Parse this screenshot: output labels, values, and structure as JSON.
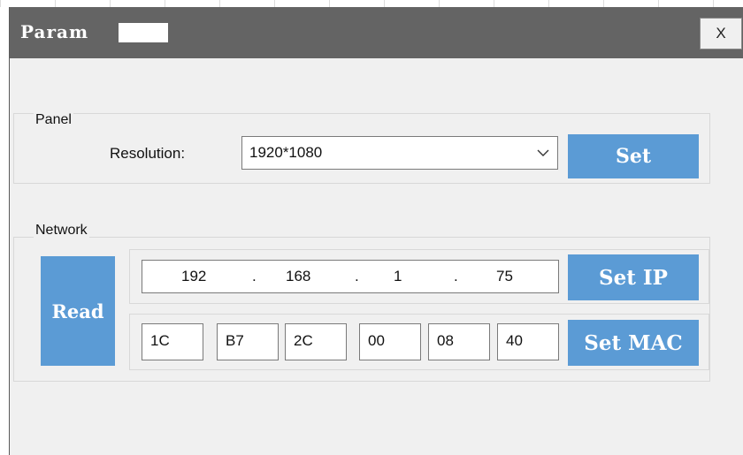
{
  "window": {
    "title": "Param",
    "close_label": "X"
  },
  "panel": {
    "group_label": "Panel",
    "resolution_label": "Resolution:",
    "resolution_value": "1920*1080",
    "set_label": "Set"
  },
  "network": {
    "group_label": "Network",
    "read_label": "Read",
    "ip": [
      "192",
      "168",
      "1",
      "75"
    ],
    "ip_separator": ".",
    "set_ip_label": "Set IP",
    "mac": [
      "1C",
      "B7",
      "2C",
      "00",
      "08",
      "40"
    ],
    "set_mac_label": "Set MAC"
  },
  "colors": {
    "titlebar": "#646464",
    "button": "#5b9bd5",
    "dialog": "#f0f0f0"
  },
  "icons": {
    "dropdown": "chevron-down-icon"
  }
}
